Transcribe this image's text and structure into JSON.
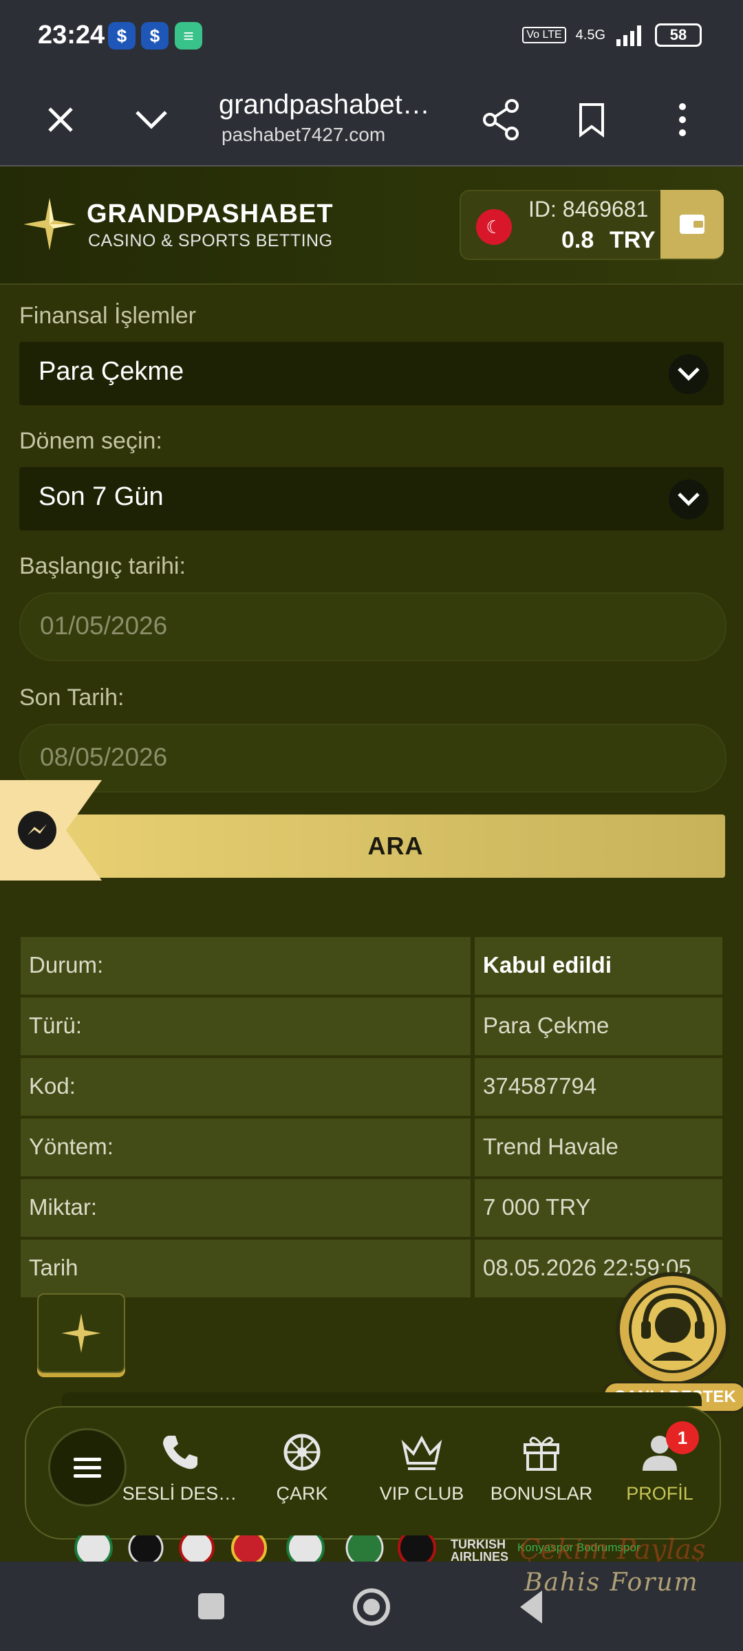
{
  "status_bar": {
    "time": "23:24",
    "network": "4.5G",
    "battery": "58"
  },
  "browser": {
    "title": "grandpashabet…",
    "url": "pashabet7427.com"
  },
  "header": {
    "brand": "GRANDPASHABET",
    "tagline": "CASINO & SPORTS BETTING",
    "account_id": "ID: 8469681",
    "balance": "0.8",
    "currency": "TRY"
  },
  "form": {
    "finance_label": "Finansal İşlemler",
    "finance_value": "Para Çekme",
    "period_label": "Dönem seçin:",
    "period_value": "Son 7 Gün",
    "start_label": "Başlangıç tarihi:",
    "start_value": "01/05/2026",
    "end_label": "Son Tarih:",
    "end_value": "08/05/2026",
    "search_button": "ARA"
  },
  "details": [
    {
      "label": "Durum:",
      "value": "Kabul edildi"
    },
    {
      "label": "Türü:",
      "value": "Para Çekme"
    },
    {
      "label": "Kod:",
      "value": "374587794"
    },
    {
      "label": "Yöntem:",
      "value": "Trend Havale"
    },
    {
      "label": "Miktar:",
      "value": "7 000 TRY"
    },
    {
      "label": "Tarih",
      "value": "08.05.2026 22:59:05"
    }
  ],
  "support": {
    "label": "CANLI DESTEK"
  },
  "nav": {
    "items": [
      {
        "label": "SESLİ DES…",
        "icon": "phone-icon"
      },
      {
        "label": "ÇARK",
        "icon": "wheel-icon"
      },
      {
        "label": "VIP CLUB",
        "icon": "crown-icon"
      },
      {
        "label": "BONUSLAR",
        "icon": "gift-icon"
      },
      {
        "label": "PROFİL",
        "icon": "profile-icon",
        "badge": "1"
      }
    ]
  },
  "footer": {
    "sponsor_line1": "TURKISH",
    "sponsor_line2": "AIRLINES",
    "club_text": "Konyaspor Bodrumspor",
    "watermark_line1": "Çekim Paylaş",
    "watermark_line2": "Bahis Forum"
  },
  "colors": {
    "accent_gold": "#c9b25a",
    "panel": "#434b16",
    "active_nav": "#c8c454"
  }
}
